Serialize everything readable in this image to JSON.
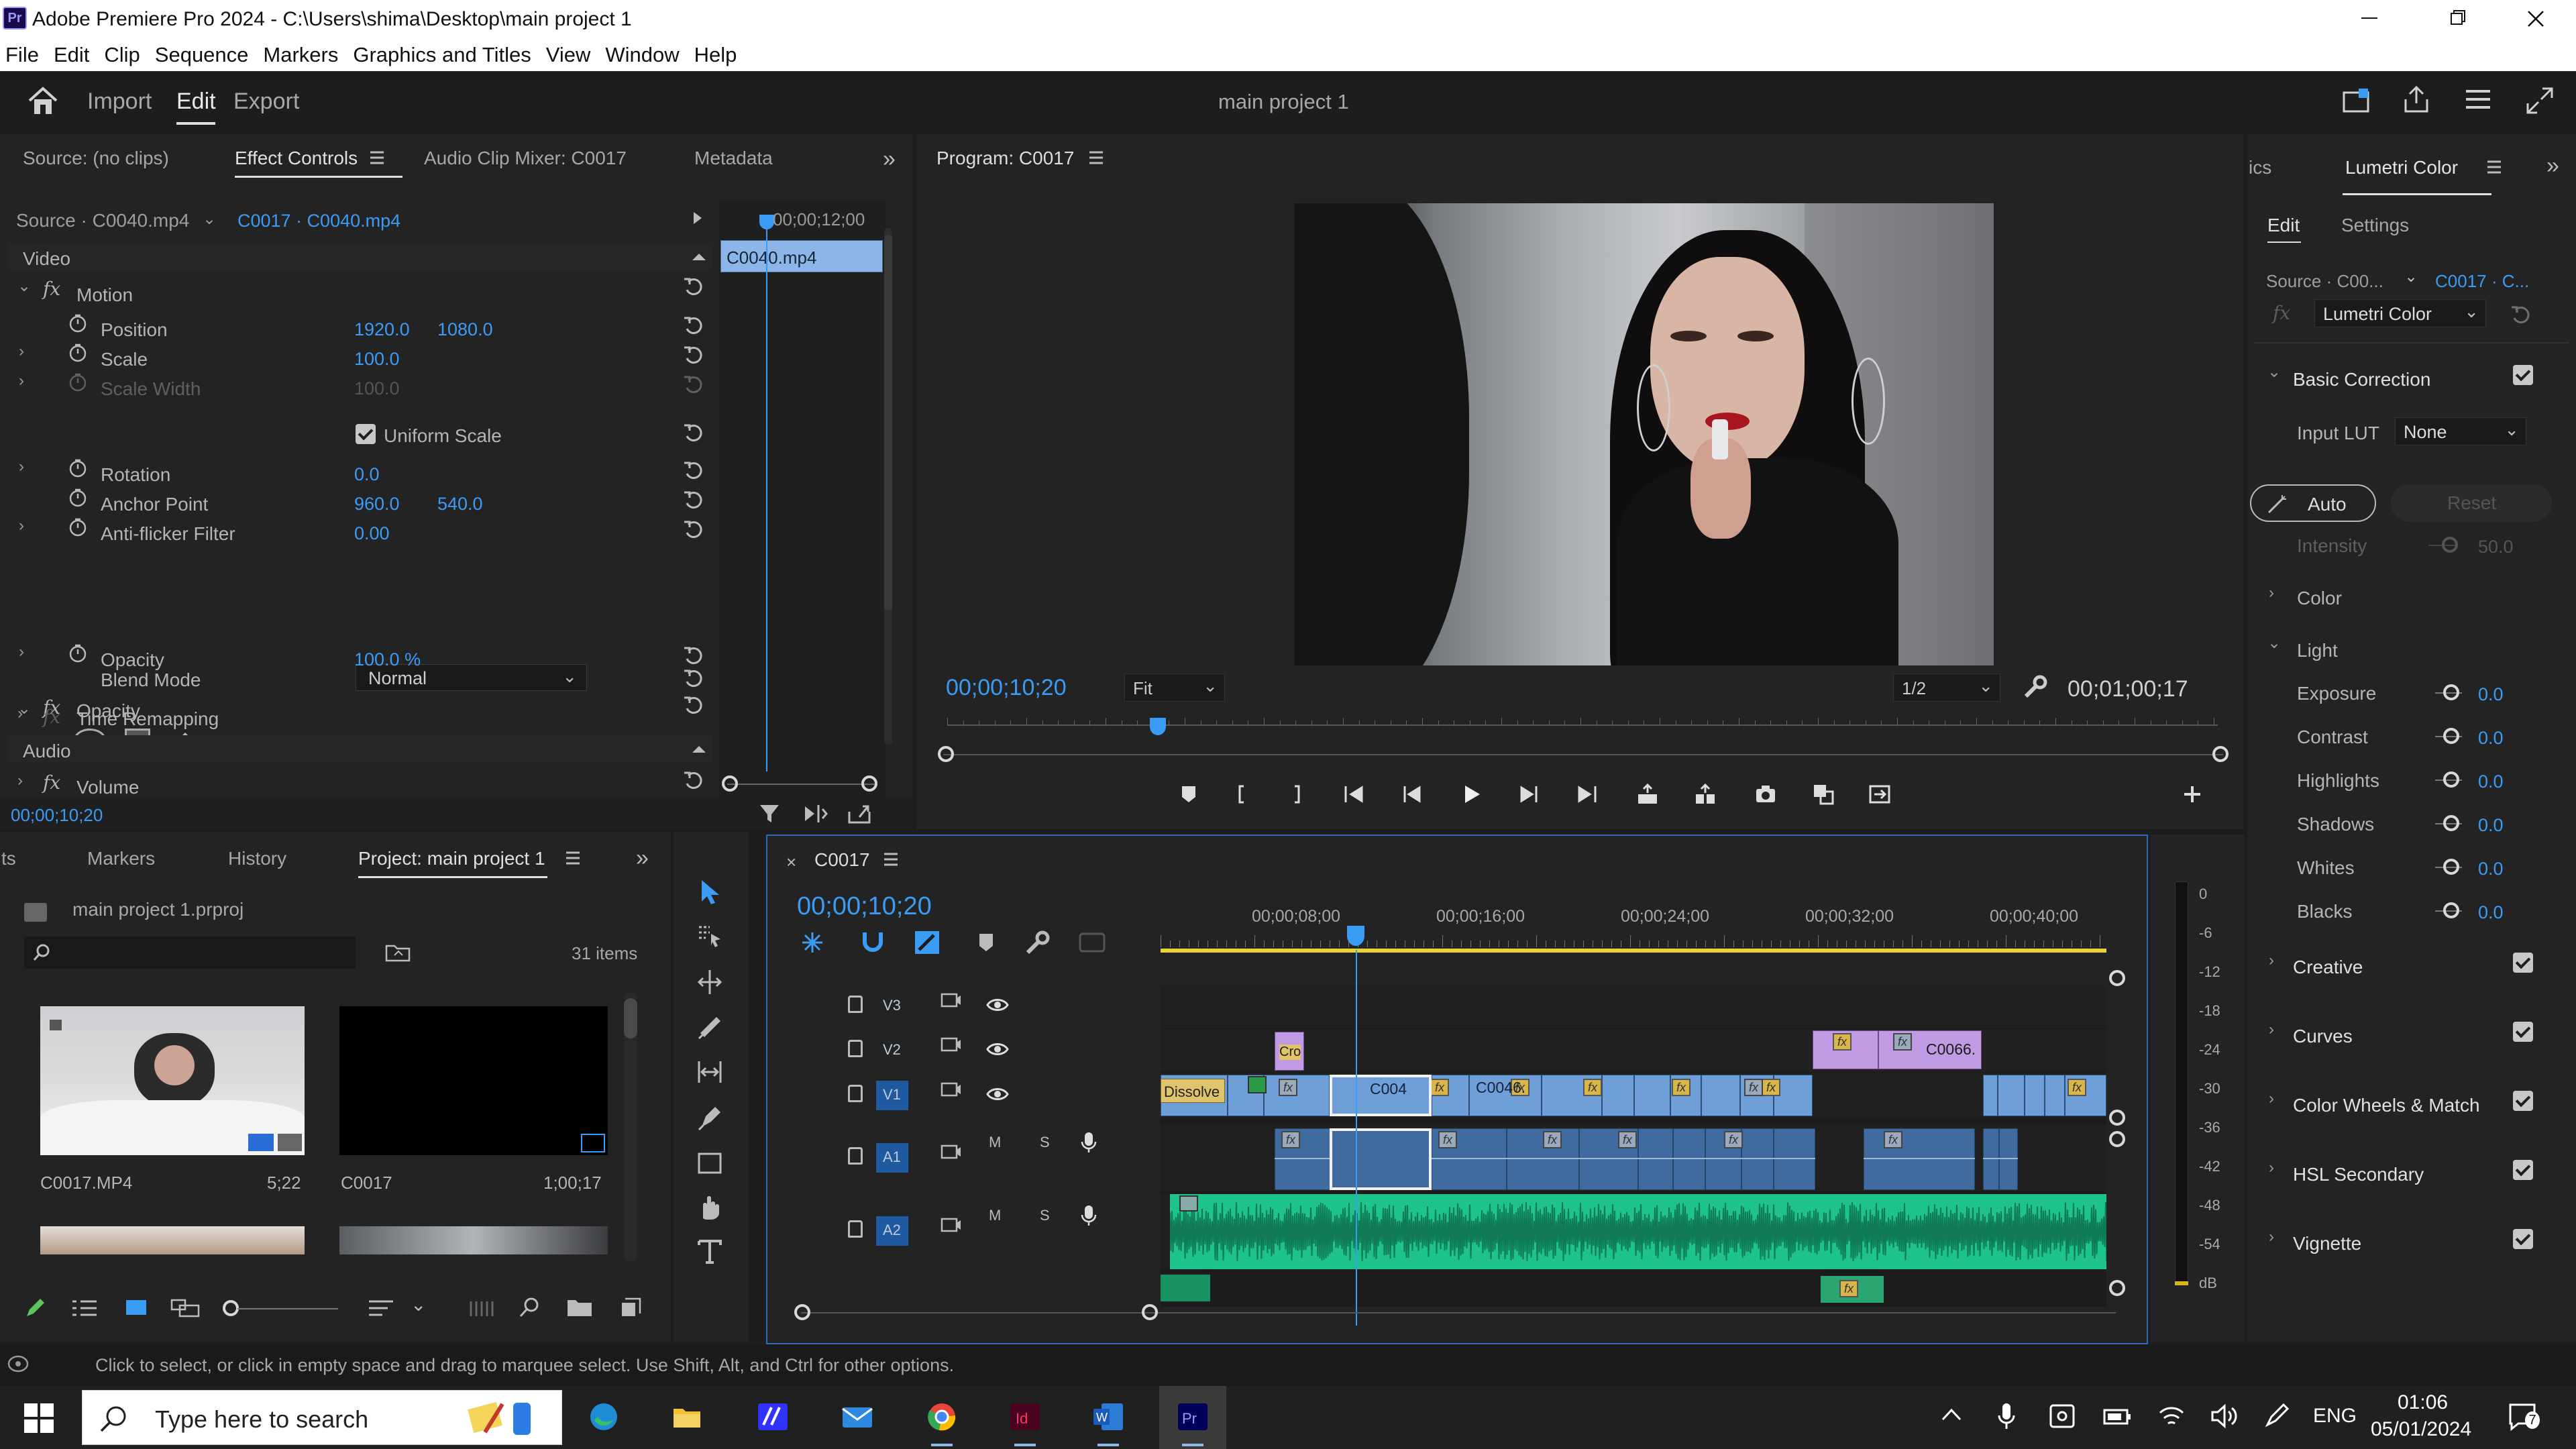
{
  "window": {
    "app_badge": "Pr",
    "title": "Adobe Premiere Pro 2024 - C:\\Users\\shima\\Desktop\\main project 1"
  },
  "menu": [
    "File",
    "Edit",
    "Clip",
    "Sequence",
    "Markers",
    "Graphics and Titles",
    "View",
    "Window",
    "Help"
  ],
  "workspace": {
    "tabs": [
      "Import",
      "Edit",
      "Export"
    ],
    "active": "Edit",
    "project_title": "main project 1"
  },
  "source_panel": {
    "tabs": [
      "Source: (no clips)",
      "Effect Controls",
      "Audio Clip Mixer: C0017",
      "Metadata"
    ],
    "active": "Effect Controls",
    "source_label": "Source · C0040.mp4",
    "sequence_label": "C0017 · C0040.mp4",
    "timecode_head": "00;00;12;00",
    "mini_clip": "C0040.mp4",
    "video_header": "Video",
    "audio_header": "Audio",
    "timecode": "00;00;10;20",
    "motion": "Motion",
    "position_label": "Position",
    "position_x": "1920.0",
    "position_y": "1080.0",
    "scale_label": "Scale",
    "scale": "100.0",
    "scale_width_label": "Scale Width",
    "scale_width": "100.0",
    "uniform_scale": "Uniform Scale",
    "rotation_label": "Rotation",
    "rotation": "0.0",
    "anchor_label": "Anchor Point",
    "anchor_x": "960.0",
    "anchor_y": "540.0",
    "antiflicker_label": "Anti-flicker Filter",
    "antiflicker": "0.00",
    "opacity_group": "Opacity",
    "opacity_label": "Opacity",
    "opacity": "100.0 %",
    "blend_label": "Blend Mode",
    "blend": "Normal",
    "time_remap": "Time Remapping",
    "volume": "Volume"
  },
  "program": {
    "title": "Program: C0017",
    "timecode": "00;00;10;20",
    "fit": "Fit",
    "resolution": "1/2",
    "duration": "00;01;00;17"
  },
  "lumetri": {
    "partial_tab": "ics",
    "title": "Lumetri Color",
    "subtabs": [
      "Edit",
      "Settings"
    ],
    "source": "Source · C00...",
    "sequence": "C0017 · C...",
    "effect": "Lumetri Color",
    "basic": "Basic Correction",
    "input_lut_label": "Input LUT",
    "input_lut": "None",
    "auto": "Auto",
    "reset": "Reset",
    "intensity_label": "Intensity",
    "intensity": "50.0",
    "color": "Color",
    "light": "Light",
    "light_rows": [
      {
        "label": "Exposure",
        "value": "0.0"
      },
      {
        "label": "Contrast",
        "value": "0.0"
      },
      {
        "label": "Highlights",
        "value": "0.0"
      },
      {
        "label": "Shadows",
        "value": "0.0"
      },
      {
        "label": "Whites",
        "value": "0.0"
      },
      {
        "label": "Blacks",
        "value": "0.0"
      }
    ],
    "sections": [
      "Creative",
      "Curves",
      "Color Wheels & Match",
      "HSL Secondary",
      "Vignette"
    ]
  },
  "project_panel": {
    "tabs": [
      "ts",
      "Markers",
      "History",
      "Project: main project 1"
    ],
    "active": "Project: main project 1",
    "file": "main project 1.prproj",
    "items": "31 items",
    "thumbs": [
      {
        "name": "C0017.MP4",
        "duration": "5;22"
      },
      {
        "name": "C0017",
        "duration": "1;00;17"
      }
    ]
  },
  "timeline": {
    "sequence": "C0017",
    "timecode": "00;00;10;20",
    "ruler": [
      "00;00;08;00",
      "00;00;16;00",
      "00;00;24;00",
      "00;00;32;00",
      "00;00;40;00"
    ],
    "tracks": [
      "V3",
      "V2",
      "V1",
      "A1",
      "A2"
    ],
    "track_btn_m": "M",
    "track_btn_s": "S",
    "clip_labels": {
      "cro": "Cro",
      "dissolve": "Dissolve",
      "c004": "C004",
      "c0046": "C0046.",
      "c0066": "C0066."
    }
  },
  "meter": {
    "scale": [
      "0",
      "-6",
      "-12",
      "-18",
      "-24",
      "-30",
      "-36",
      "-42",
      "-48",
      "-54",
      "dB"
    ]
  },
  "status": "Click to select, or click in empty space and drag to marquee select. Use Shift, Alt, and Ctrl for other options.",
  "taskbar": {
    "search": "Type here to search",
    "lang": "ENG",
    "time": "01:06",
    "date": "05/01/2024",
    "notif": "7"
  }
}
